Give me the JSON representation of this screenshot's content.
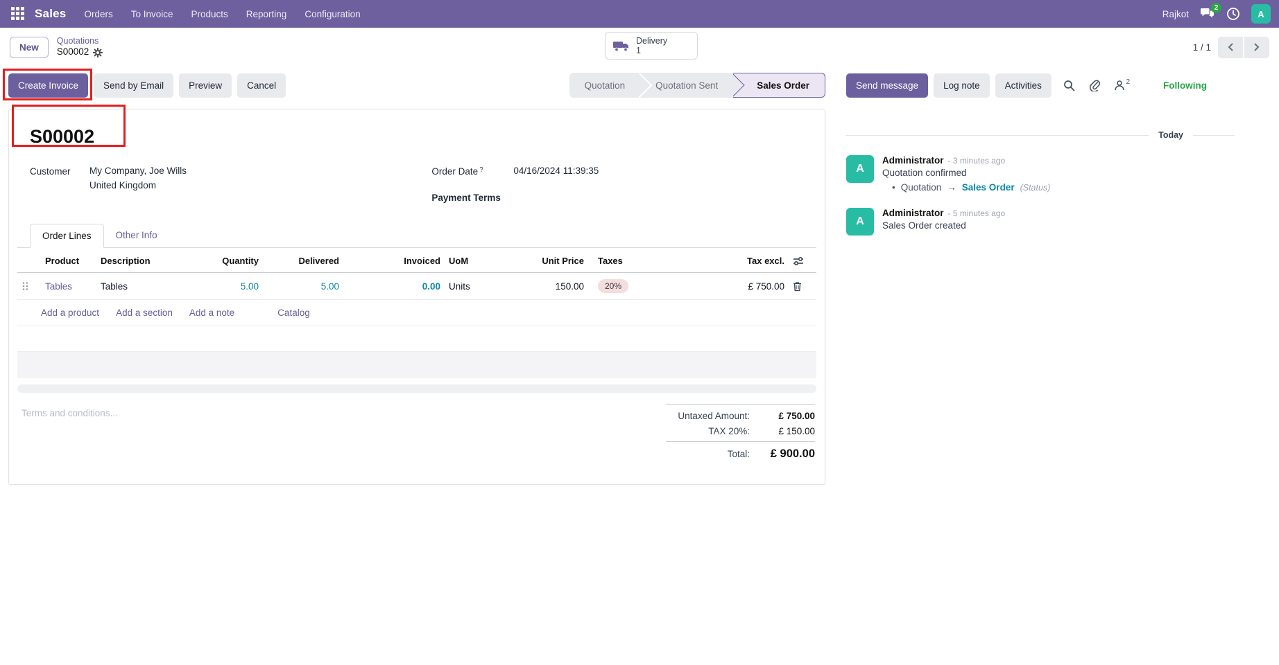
{
  "nav": {
    "app_name": "Sales",
    "items": [
      "Orders",
      "To Invoice",
      "Products",
      "Reporting",
      "Configuration"
    ],
    "company": "Rajkot",
    "chat_badge": "2",
    "avatar_initial": "A"
  },
  "breadcrumb": {
    "new_button": "New",
    "parent": "Quotations",
    "current": "S00002"
  },
  "smart_button": {
    "label": "Delivery",
    "count": "1"
  },
  "pager": {
    "text": "1 / 1"
  },
  "actions": {
    "create_invoice": "Create Invoice",
    "send_by_email": "Send by Email",
    "preview": "Preview",
    "cancel": "Cancel"
  },
  "statusbar": {
    "steps": [
      {
        "label": "Quotation"
      },
      {
        "label": "Quotation Sent"
      },
      {
        "label": "Sales Order"
      }
    ]
  },
  "chatter": {
    "send_message": "Send message",
    "log_note": "Log note",
    "activities": "Activities",
    "followers_count": "2",
    "following": "Following",
    "divider": "Today",
    "messages": [
      {
        "avatar_initial": "A",
        "author": "Administrator",
        "time": "- 3 minutes ago",
        "body": "Quotation confirmed",
        "tracking": {
          "bullet": "•",
          "from": "Quotation",
          "arrow": "→",
          "to": "Sales Order",
          "field": "(Status)"
        }
      },
      {
        "avatar_initial": "A",
        "author": "Administrator",
        "time": "- 5 minutes ago",
        "body": "Sales Order created"
      }
    ]
  },
  "form": {
    "title": "S00002",
    "customer_label": "Customer",
    "customer": "My Company, Joe Wills",
    "customer_country": "United Kingdom",
    "order_date_label": "Order Date",
    "order_date_help": "?",
    "order_date": "04/16/2024 11:39:35",
    "payment_terms_label": "Payment Terms",
    "tabs": [
      {
        "label": "Order Lines"
      },
      {
        "label": "Other Info"
      }
    ],
    "table": {
      "headers": [
        "Product",
        "Description",
        "Quantity",
        "Delivered",
        "Invoiced",
        "UoM",
        "Unit Price",
        "Taxes",
        "Tax excl."
      ],
      "rows": [
        {
          "product": "Tables",
          "description": "Tables",
          "quantity": "5.00",
          "delivered": "5.00",
          "invoiced": "0.00",
          "uom": "Units",
          "unit_price": "150.00",
          "taxes": "20%",
          "subtotal": "£ 750.00"
        }
      ],
      "links": [
        "Add a product",
        "Add a section",
        "Add a note",
        "Catalog"
      ]
    },
    "terms_placeholder": "Terms and conditions...",
    "totals": {
      "untaxed_label": "Untaxed Amount:",
      "untaxed": "£ 750.00",
      "tax_label": "TAX 20%:",
      "tax": "£ 150.00",
      "total_label": "Total:",
      "total": "£ 900.00"
    }
  },
  "colors": {
    "primary": "#6c5f9d",
    "navbar": "#6e609e",
    "link": "#65609c",
    "teal_number": "#0c87a6",
    "following_green": "#28a745",
    "avatar_teal": "#28bca4",
    "tax_pill_bg": "#f1dedd",
    "annotation_red": "#e71d1d"
  }
}
